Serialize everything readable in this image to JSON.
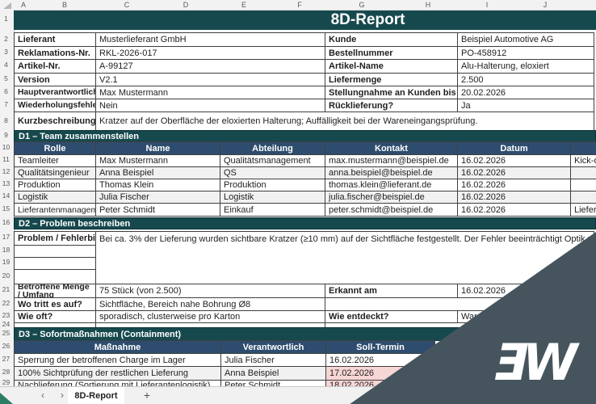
{
  "title": "8D-Report",
  "grid": {
    "cols": [
      "A",
      "B",
      "C",
      "D",
      "E",
      "F",
      "G",
      "H",
      "I",
      "J"
    ],
    "rows": [
      "1",
      "2",
      "3",
      "4",
      "5",
      "6",
      "7",
      "8",
      "9",
      "10",
      "11",
      "12",
      "13",
      "14",
      "15",
      "16",
      "17",
      "18",
      "19",
      "20",
      "21",
      "22",
      "23",
      "24",
      "25",
      "26",
      "27",
      "28",
      "29"
    ]
  },
  "info": {
    "left": [
      {
        "label": "Lieferant",
        "value": "Musterlieferant GmbH"
      },
      {
        "label": "Reklamations-Nr.",
        "value": "RKL-2026-017"
      },
      {
        "label": "Artikel-Nr.",
        "value": "A-99127"
      },
      {
        "label": "Version",
        "value": "V2.1"
      },
      {
        "label": "Hauptverantwortlicher",
        "value": "Max Mustermann"
      },
      {
        "label": "Wiederholungsfehler?",
        "value": "Nein"
      }
    ],
    "right": [
      {
        "label": "Kunde",
        "value": "Beispiel Automotive AG"
      },
      {
        "label": "Bestellnummer",
        "value": "PO-458912"
      },
      {
        "label": "Artikel-Name",
        "value": "Alu-Halterung, eloxiert"
      },
      {
        "label": "Liefermenge",
        "value": "2.500"
      },
      {
        "label": "Stellungnahme an Kunden bis",
        "value": "20.02.2026"
      },
      {
        "label": "Rücklieferung?",
        "value": "Ja"
      }
    ],
    "short_desc_label": "Kurzbeschreibung",
    "short_desc_value": "Kratzer auf der Oberfläche der eloxierten Halterung; Auffälligkeit bei der Wareneingangsprüfung."
  },
  "d1": {
    "section_title": "D1 – Team zusammenstellen",
    "headers": [
      "Rolle",
      "Name",
      "Abteilung",
      "Kontakt",
      "Datum"
    ],
    "rows": [
      [
        "Teamleiter",
        "Max Mustermann",
        "Qualitätsmanagement",
        "max.mustermann@beispiel.de",
        "16.02.2026",
        "Kick-of"
      ],
      [
        "Qualitätsingenieur",
        "Anna Beispiel",
        "QS",
        "anna.beispiel@beispiel.de",
        "16.02.2026",
        ""
      ],
      [
        "Produktion",
        "Thomas Klein",
        "Produktion",
        "thomas.klein@lieferant.de",
        "16.02.2026",
        ""
      ],
      [
        "Logistik",
        "Julia Fischer",
        "Logistik",
        "julia.fischer@beispiel.de",
        "16.02.2026",
        ""
      ],
      [
        "Lieferantenmanagement",
        "Peter Schmidt",
        "Einkauf",
        "peter.schmidt@beispiel.de",
        "16.02.2026",
        "Liefera"
      ]
    ]
  },
  "d2": {
    "section_title": "D2 – Problem beschreiben",
    "problem_label": "Problem / Fehlerbild",
    "problem_text": "Bei ca. 3% der Lieferung wurden sichtbare Kratzer (≥10 mm) auf der Sichtfläche festgestellt. Der Fehler beeinträchtigt Optik und Montagefreigabe.",
    "fields": [
      {
        "label": "Betroffene Menge / Umfang",
        "value": "75 Stück (von 2.500)",
        "label2": "Erkannt am",
        "value2": "16.02.2026"
      },
      {
        "label": "Wo tritt es auf?",
        "value": "Sichtfläche, Bereich nahe Bohrung Ø8",
        "label2": "",
        "value2": ""
      },
      {
        "label": "Wie oft?",
        "value": "sporadisch, clusterweise pro Karton",
        "label2": "Wie entdeckt?",
        "value2": "Ware"
      }
    ]
  },
  "d3": {
    "section_title": "D3 – Sofortmaßnahmen (Containment)",
    "headers": [
      "Maßnahme",
      "Verantwortlich",
      "Soll-Termin"
    ],
    "rows": [
      {
        "massnahme": "Sperrung der betroffenen Charge im Lager",
        "verantwortlich": "Julia Fischer",
        "termin": "16.02.2026"
      },
      {
        "massnahme": "100% Sichtprüfung der restlichen Lieferung",
        "verantwortlich": "Anna Beispiel",
        "termin": "17.02.2026"
      },
      {
        "massnahme": "Nachlieferung (Sortierung mit Lieferantenlogistik)",
        "verantwortlich": "Peter Schmidt",
        "termin": "18.02.2026"
      }
    ]
  },
  "tab_bar": {
    "prev_label": "‹",
    "next_label": "›",
    "active_tab_label": "8D-Report",
    "add_label": "+"
  },
  "watermark": {
    "logo_text": "ƎW"
  },
  "colors": {
    "teal_header": "#16494e",
    "navy_table_header": "#2e4d6e",
    "highlight_pink": "#f7d6d6",
    "overlay_slate": "#46555d",
    "tab_accent_green": "#1e7447"
  }
}
